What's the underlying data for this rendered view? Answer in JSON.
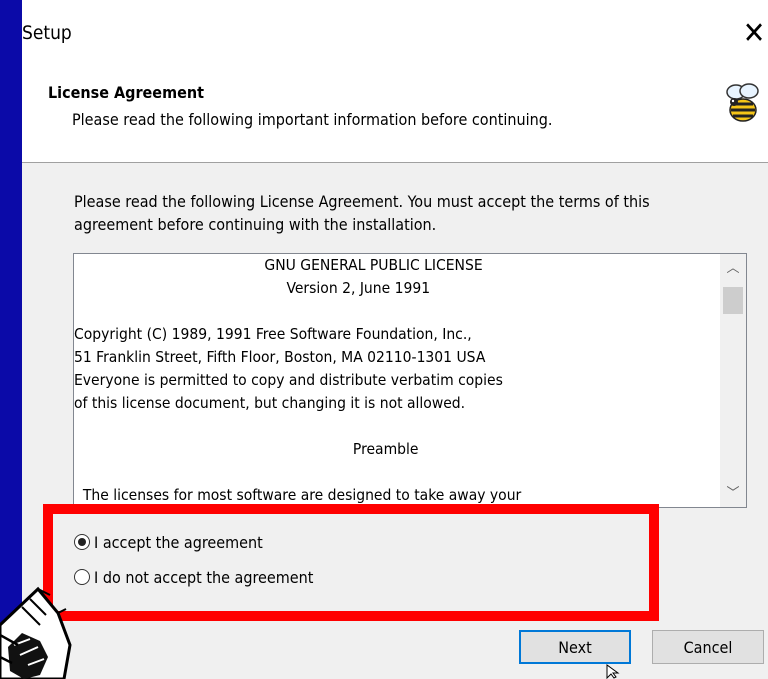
{
  "window": {
    "title": "Setup"
  },
  "header": {
    "title": "License Agreement",
    "subtitle": "Please read the following important information before continuing.",
    "icon": "bee-icon"
  },
  "intro_text": "Please read the following License Agreement. You must accept the terms of this agreement before continuing with the installation.",
  "license_lines": [
    "                                           GNU GENERAL PUBLIC LICENSE",
    "                                                Version 2, June 1991",
    "",
    "Copyright (C) 1989, 1991 Free Software Foundation, Inc.,",
    "51 Franklin Street, Fifth Floor, Boston, MA 02110-1301 USA",
    "Everyone is permitted to copy and distribute verbatim copies",
    "of this license document, but changing it is not allowed.",
    "",
    "                                                               Preamble",
    "",
    "  The licenses for most software are designed to take away your"
  ],
  "options": {
    "accept_label": "I accept the agreement",
    "decline_label": "I do not accept the agreement",
    "selected": "accept"
  },
  "buttons": {
    "next_label": "Next",
    "cancel_label": "Cancel"
  },
  "colors": {
    "desktop_background": "#0b0aa8",
    "highlight_box": "#ff0000",
    "default_button_border": "#0078d7"
  }
}
